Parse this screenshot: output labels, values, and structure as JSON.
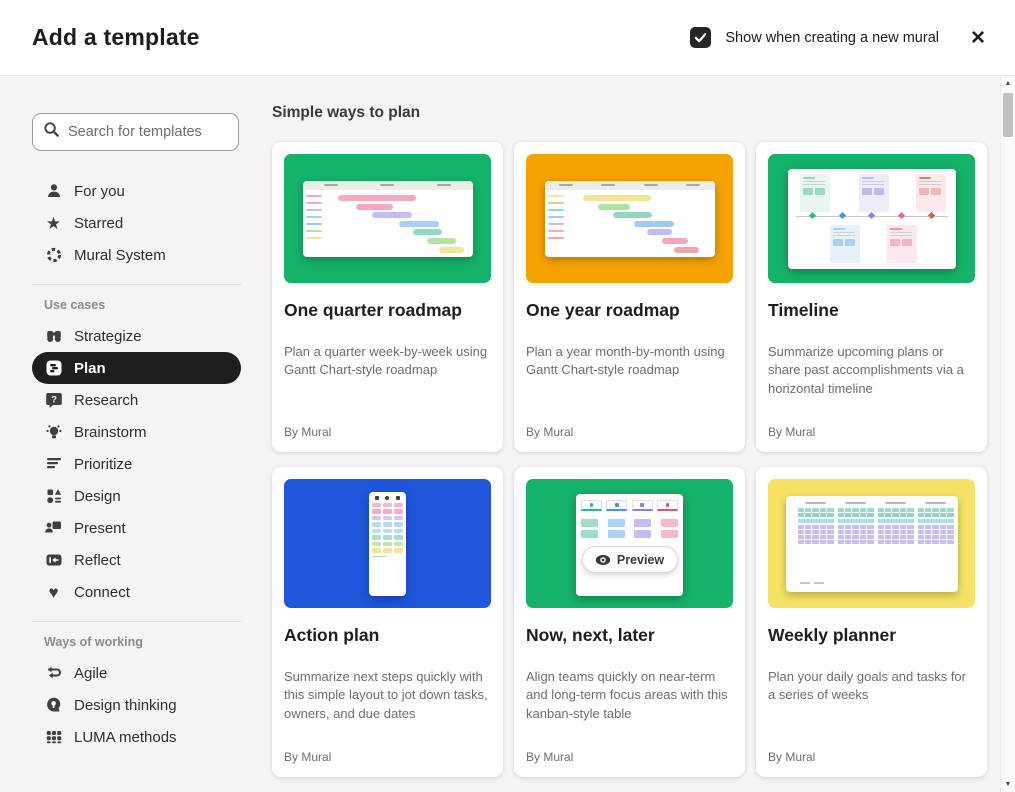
{
  "header": {
    "title": "Add a template",
    "checkbox_label": "Show when creating a new mural",
    "checkbox_checked": true
  },
  "icons": {
    "close": "×",
    "star": "★",
    "heart": "♥",
    "scroll_up": "▲",
    "scroll_down": "▼"
  },
  "sidebar": {
    "search": {
      "placeholder": "Search for templates"
    },
    "primary": [
      {
        "label": "For you",
        "icon": "person-icon"
      },
      {
        "label": "Starred",
        "icon": "star-icon"
      },
      {
        "label": "Mural System",
        "icon": "mural-system-icon"
      }
    ],
    "use_cases": {
      "title": "Use cases",
      "items": [
        {
          "label": "Strategize",
          "icon": "binoculars-icon",
          "selected": false
        },
        {
          "label": "Plan",
          "icon": "gantt-icon",
          "selected": true
        },
        {
          "label": "Research",
          "icon": "question-bubble-icon",
          "selected": false
        },
        {
          "label": "Brainstorm",
          "icon": "lightbulb-icon",
          "selected": false
        },
        {
          "label": "Prioritize",
          "icon": "ranked-lines-icon",
          "selected": false
        },
        {
          "label": "Design",
          "icon": "shapes-icon",
          "selected": false
        },
        {
          "label": "Present",
          "icon": "presenter-icon",
          "selected": false
        },
        {
          "label": "Reflect",
          "icon": "arrow-to-start-icon",
          "selected": false
        },
        {
          "label": "Connect",
          "icon": "heart-icon",
          "selected": false
        }
      ]
    },
    "ways_of_working": {
      "title": "Ways of working",
      "items": [
        {
          "label": "Agile",
          "icon": "loop-arrows-icon"
        },
        {
          "label": "Design thinking",
          "icon": "head-icon"
        },
        {
          "label": "LUMA methods",
          "icon": "grid-icon"
        }
      ]
    }
  },
  "main": {
    "section_title": "Simple ways to plan",
    "preview_label": "Preview",
    "cards": [
      {
        "title": "One quarter roadmap",
        "description": "Plan a quarter week-by-week using Gantt Chart-style roadmap",
        "byline": "By Mural",
        "thumb_color": "#15B269",
        "thumb_style": "background:#15B269"
      },
      {
        "title": "One year roadmap",
        "description": "Plan a year month-by-month using Gantt Chart-style roadmap",
        "byline": "By Mural",
        "thumb_color": "#F5A300",
        "thumb_style": "background:#F5A300"
      },
      {
        "title": "Timeline",
        "description": "Summarize upcoming plans or share past accomplishments via a horizontal timeline",
        "byline": "By Mural",
        "thumb_color": "#15B269",
        "thumb_style": "background:#15B269"
      },
      {
        "title": "Action plan",
        "description": "Summarize next steps quickly with this simple layout to jot down tasks, owners, and due dates",
        "byline": "By Mural",
        "thumb_color": "#1E57DC",
        "thumb_style": "background:#1E57DC"
      },
      {
        "title": "Now, next, later",
        "description": "Align teams quickly on near-term and long-term focus areas with this kanban-style table",
        "byline": "By Mural",
        "thumb_color": "#15B269",
        "thumb_style": "background:#15B269"
      },
      {
        "title": "Weekly planner",
        "description": "Plan your daily goals and tasks for a series of weeks",
        "byline": "By Mural",
        "thumb_color": "#F6E365",
        "thumb_style": "background:#F6E365"
      }
    ]
  }
}
